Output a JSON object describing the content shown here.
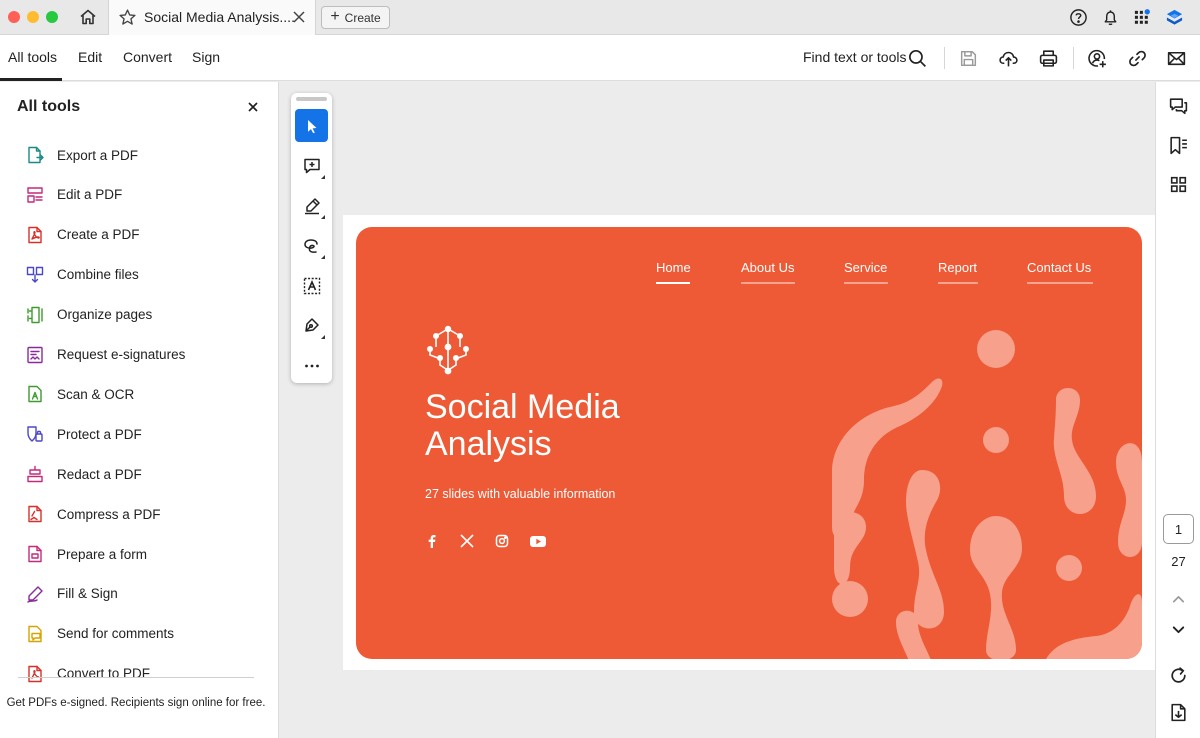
{
  "titlebar": {
    "tab_title": "Social Media Analysis....",
    "create_label": "Create"
  },
  "menubar": {
    "items": [
      "All tools",
      "Edit",
      "Convert",
      "Sign"
    ],
    "active": "All tools",
    "find_label": "Find text or tools"
  },
  "left_panel": {
    "title": "All tools",
    "tools": [
      {
        "label": "Export a PDF",
        "icon": "export-pdf-icon",
        "color": "#1a8a84"
      },
      {
        "label": "Edit a PDF",
        "icon": "edit-pdf-icon",
        "color": "#c42a7a"
      },
      {
        "label": "Create a PDF",
        "icon": "create-pdf-icon",
        "color": "#d8302c"
      },
      {
        "label": "Combine files",
        "icon": "combine-files-icon",
        "color": "#4b48c7"
      },
      {
        "label": "Organize pages",
        "icon": "organize-pages-icon",
        "color": "#3f9a2f"
      },
      {
        "label": "Request e-signatures",
        "icon": "request-esignatures-icon",
        "color": "#8a2a9a"
      },
      {
        "label": "Scan & OCR",
        "icon": "scan-ocr-icon",
        "color": "#3f9a2f"
      },
      {
        "label": "Protect a PDF",
        "icon": "protect-pdf-icon",
        "color": "#4b48c7"
      },
      {
        "label": "Redact a PDF",
        "icon": "redact-pdf-icon",
        "color": "#c42a7a"
      },
      {
        "label": "Compress a PDF",
        "icon": "compress-pdf-icon",
        "color": "#d8302c"
      },
      {
        "label": "Prepare a form",
        "icon": "prepare-form-icon",
        "color": "#c42a7a"
      },
      {
        "label": "Fill & Sign",
        "icon": "fill-sign-icon",
        "color": "#8a2a9a"
      },
      {
        "label": "Send for comments",
        "icon": "send-comments-icon",
        "color": "#d6a400"
      },
      {
        "label": "Convert to PDF",
        "icon": "convert-pdf-icon",
        "color": "#d8302c"
      }
    ],
    "footer": "Get PDFs e-signed. Recipients sign online for free."
  },
  "slide": {
    "nav": [
      "Home",
      "About Us",
      "Service",
      "Report",
      "Contact Us"
    ],
    "title_line1": "Social Media",
    "title_line2": "Analysis",
    "subtitle": "27 slides with valuable information",
    "background_color": "#ee5a35",
    "blob_color": "#f7a08c"
  },
  "pagination": {
    "current": "1",
    "total": "27"
  },
  "colors": {
    "accent": "#1473e6",
    "notification_dot": "#1473e6"
  }
}
